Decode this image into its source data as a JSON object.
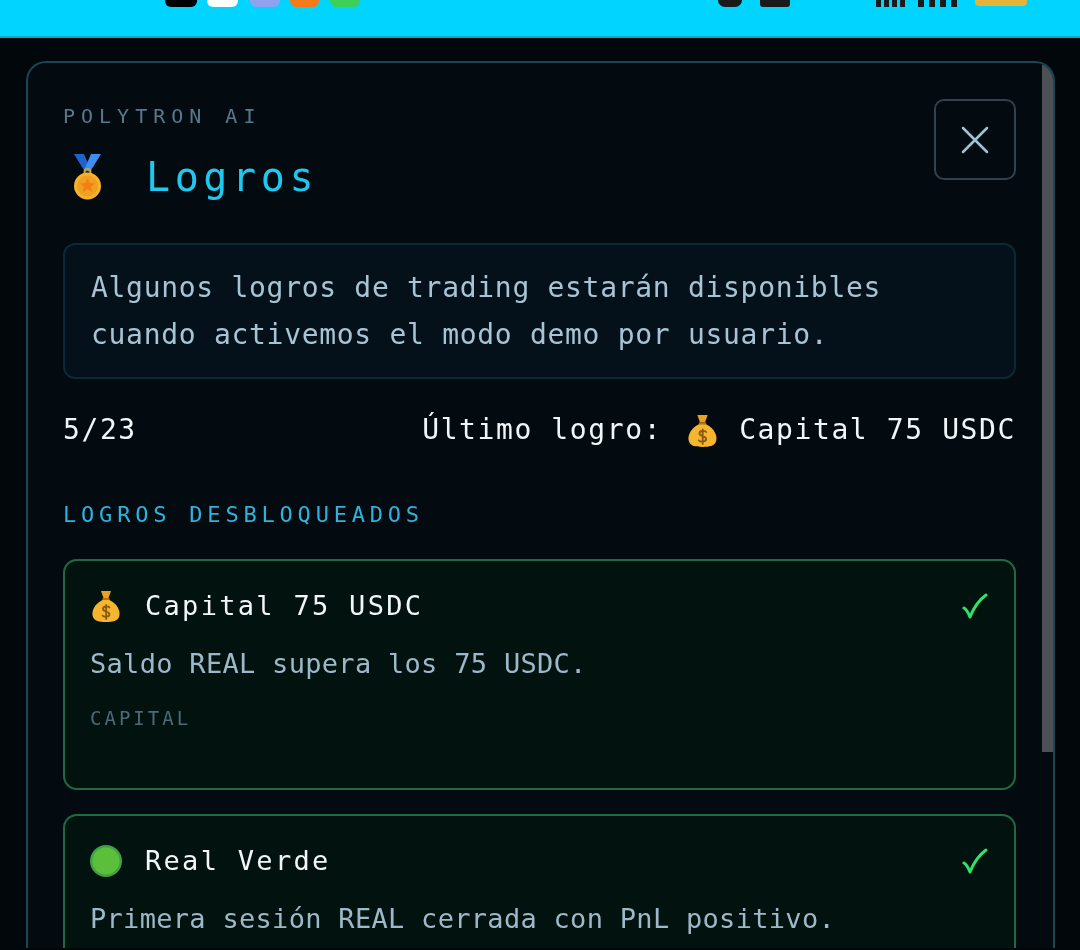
{
  "modal": {
    "brand": "POLYTRON AI",
    "title": "Logros",
    "notice": "Algunos logros de trading estarán disponibles cuando activemos el modo demo por usuario.",
    "progress": "5/23",
    "latest": {
      "label": "Último logro:",
      "kind": "money",
      "name": "Capital 75 USDC"
    },
    "section_title": "LOGROS DESBLOQUEADOS",
    "achievements": [
      {
        "kind": "money",
        "title": "Capital 75 USDC",
        "unlocked": true,
        "description": "Saldo REAL supera los 75 USDC.",
        "category": "CAPITAL"
      },
      {
        "kind": "circle",
        "title": "Real Verde",
        "unlocked": true,
        "description": "Primera sesión REAL cerrada con PnL positivo."
      }
    ]
  }
}
